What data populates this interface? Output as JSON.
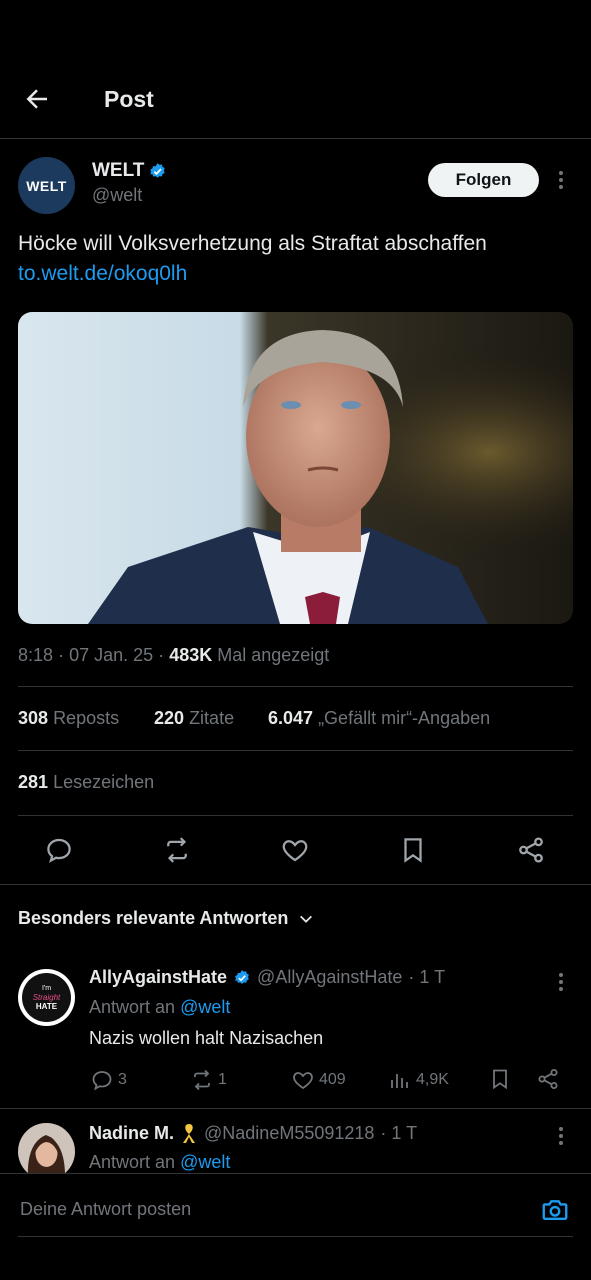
{
  "header": {
    "title": "Post",
    "back_icon": "arrow-left-icon"
  },
  "post": {
    "author": {
      "name": "WELT",
      "handle": "@welt",
      "avatar_text": "WELT",
      "verified": true
    },
    "follow_label": "Folgen",
    "text": "Höcke will Volksverhetzung als Straftat abschaffen",
    "link": "to.welt.de/okoq0lh",
    "meta": {
      "time": "8:18",
      "date": "07 Jan. 25",
      "views": "483K",
      "views_label": "Mal angezeigt",
      "sep": "·"
    },
    "stats": {
      "reposts": "308",
      "reposts_label": "Reposts",
      "quotes": "220",
      "quotes_label": "Zitate",
      "likes": "6.047",
      "likes_label": "„Gefällt mir“-Angaben",
      "bookmarks": "281",
      "bookmarks_label": "Lesezeichen"
    },
    "actions": [
      "reply-icon",
      "repost-icon",
      "like-icon",
      "bookmark-icon",
      "share-icon"
    ]
  },
  "replies_header": {
    "label": "Besonders relevante Antworten"
  },
  "replies": [
    {
      "name": "AllyAgainstHate",
      "handle": "@AllyAgainstHate",
      "time": "· 1 T",
      "verified": true,
      "reply_to_label": "Antwort an",
      "reply_to": "@welt",
      "text": "Nazis wollen halt Nazisachen",
      "avatar_text": {
        "line1": "I'm",
        "line2": "Straight",
        "line3": "HATE"
      },
      "metrics": {
        "replies": "3",
        "reposts": "1",
        "likes": "409",
        "views": "4,9K"
      }
    },
    {
      "name": "Nadine M.",
      "handle": "@NadineM55091218",
      "time": "· 1 T",
      "reply_to_label": "Antwort an",
      "reply_to": "@welt"
    }
  ],
  "composer": {
    "placeholder": "Deine Antwort posten",
    "camera_icon": "camera-icon"
  },
  "colors": {
    "accent": "#1d9bf0",
    "background": "#000000",
    "text": "#e7e9ea",
    "muted": "#71767b",
    "divider": "#2f3336",
    "ribbon": "#f4c542"
  }
}
